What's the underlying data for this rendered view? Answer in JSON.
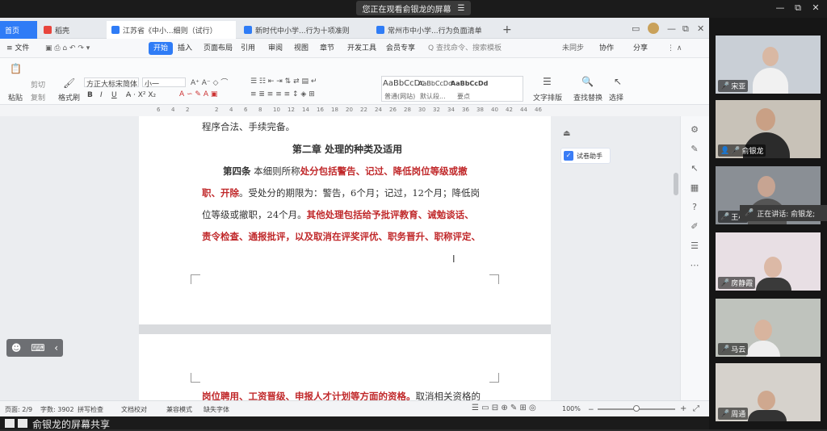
{
  "meeting": {
    "share_banner": "您正在观看俞银龙的屏幕",
    "menu_glyph": "☰",
    "window_controls": [
      "—",
      "⧉",
      "✕"
    ],
    "speaking_label": "正在讲话: 俞银龙;",
    "bottom_text": "俞银龙的屏幕共享"
  },
  "tabs": [
    {
      "label": "首页",
      "color": "#2f7cf6"
    },
    {
      "label": "稻壳",
      "color": "#e8453c"
    },
    {
      "label": "江苏省《中小...细则（试行）",
      "color": "#2f7cf6"
    },
    {
      "label": "新时代中小学...行为十项准则",
      "color": "#2f7cf6"
    },
    {
      "label": "常州市中小学...行为负面清单",
      "color": "#2f7cf6"
    }
  ],
  "menu": {
    "file": "≡ 文件",
    "items": [
      "开始",
      "插入",
      "页面布局",
      "引用",
      "审阅",
      "视图",
      "章节",
      "开发工具",
      "会员专享"
    ],
    "search_placeholder": "Q 查找命令、搜索模板",
    "right_items": [
      "未同步",
      "协作",
      "分享"
    ]
  },
  "ribbon": {
    "paste_label": "粘贴",
    "cut_label": "剪切",
    "copy_label": "复制",
    "format_painter": "格式刷",
    "font_name": "方正大标宋简体",
    "font_size": "小一",
    "styles": [
      {
        "preview": "AaBbCcDc",
        "name": "普通(网站)"
      },
      {
        "preview": "AaBbCcDd",
        "name": "默认段..."
      },
      {
        "preview": "AaBbCcDd",
        "name": "要点"
      }
    ],
    "text_layout": "文字排版",
    "find_replace": "查找替换",
    "select": "选择"
  },
  "ruler_ticks": [
    "6",
    "4",
    "2",
    "",
    "2",
    "4",
    "6",
    "8",
    "10",
    "12",
    "14",
    "16",
    "18",
    "20",
    "22",
    "24",
    "26",
    "28",
    "30",
    "32",
    "34",
    "36",
    "38",
    "40",
    "42",
    "44",
    "46"
  ],
  "document": {
    "line_prev": "程序合法、手续完备。",
    "chapter_title": "第二章   处理的种类及适用",
    "article_label": "第四条",
    "l1_a": "  本细则所称",
    "l1_b": "处分包括警告、记过、降低岗位等级或撤",
    "l2_a": "职、开除",
    "l2_b": "。受处分的期限为：警告，6个月；记过，12个月；降低岗",
    "l3_a": "位等级或撤职，24个月。",
    "l3_b": "其他处理包括给予批评教育、诫勉谈话、",
    "l4": "责令检查、通报批评，以及取消在评奖评优、职务晋升、职称评定、",
    "l5_a": "岗位聘用、工资晋级、申报人才计划等方面的资格。",
    "l5_b": "取消相关资格的"
  },
  "assistant": {
    "label": "试卷助手"
  },
  "status": {
    "page": "页面: 2/9",
    "words": "字数: 3902",
    "spell": "拼写检查",
    "proof": "文档校对",
    "compat": "兼容模式",
    "missing_font": "缺失字体",
    "zoom": "100%"
  },
  "participants": [
    {
      "name": "宋亚",
      "bg": "#c9cfd6"
    },
    {
      "name": "俞银龙",
      "bg": "#c8c2b8"
    },
    {
      "name": "王小",
      "bg": "#8a8f95"
    },
    {
      "name": "房静霞",
      "bg": "#e8dfe4"
    },
    {
      "name": "马云",
      "bg": "#bfc3bd"
    },
    {
      "name": "周通",
      "bg": "#d6d2cc"
    }
  ]
}
